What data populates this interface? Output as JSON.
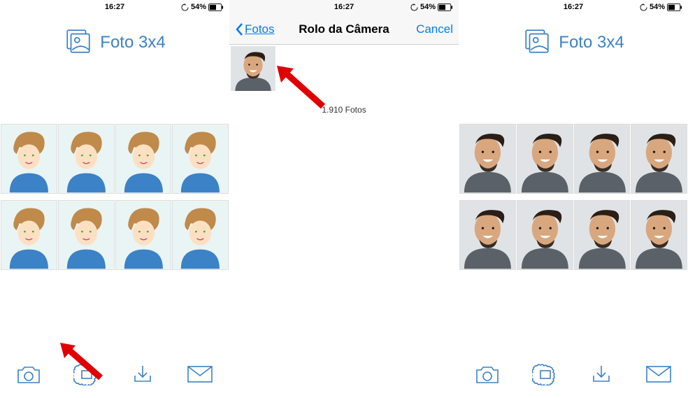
{
  "status": {
    "time_left": "16:27",
    "time_mid": "16:27",
    "time_right": "16:27",
    "battery": "54%"
  },
  "app": {
    "title": "Foto 3x4"
  },
  "picker": {
    "back": "Fotos",
    "title": "Rolo da Câmera",
    "cancel": "Cancel",
    "count": "1.910 Fotos"
  }
}
